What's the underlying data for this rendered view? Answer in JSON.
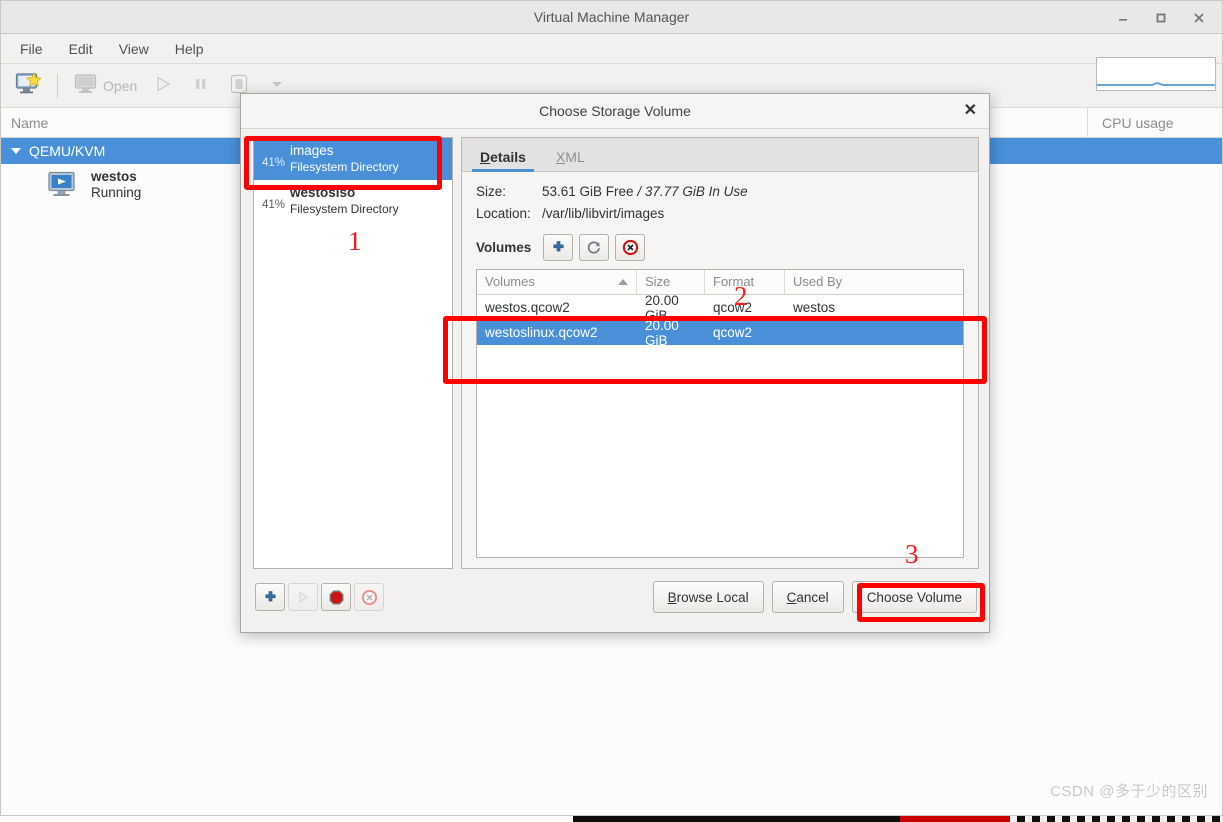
{
  "app": {
    "title": "Virtual Machine Manager",
    "window_controls": [
      {
        "name": "minimize",
        "glyph": "–"
      },
      {
        "name": "maximize",
        "glyph": "□"
      },
      {
        "name": "close",
        "glyph": "✕"
      }
    ],
    "menubar": [
      "File",
      "Edit",
      "View",
      "Help"
    ],
    "toolbar": {
      "new_vm_icon": "new-vm-icon",
      "open_label": "Open",
      "open_icon": "monitor-icon",
      "run_icon": "play-icon",
      "pause_icon": "pause-icon",
      "shutdown_icon": "shutdown-icon",
      "menu_icon": "chevron-down-icon"
    },
    "list": {
      "col_name": "Name",
      "col_cpu": "CPU usage",
      "connection": "QEMU/KVM",
      "vm_name": "westos",
      "vm_state": "Running"
    }
  },
  "dialog": {
    "title": "Choose Storage Volume",
    "close_glyph": "✕",
    "pools": [
      {
        "percent": "41%",
        "name": "images",
        "type": "Filesystem Directory",
        "selected": true
      },
      {
        "percent": "41%",
        "name": "westosiso",
        "type": "Filesystem Directory",
        "selected": false
      }
    ],
    "pool_buttons": [
      {
        "name": "add-pool-button",
        "glyph": "+",
        "enabled": true
      },
      {
        "name": "start-pool-button",
        "glyph": "▷",
        "enabled": false
      },
      {
        "name": "stop-pool-button",
        "glyph": "⬤",
        "enabled": true
      },
      {
        "name": "delete-pool-button",
        "glyph": "⊗",
        "enabled": false
      }
    ],
    "tabs": [
      {
        "label": "Details",
        "mnemonic": "D",
        "rest": "etails",
        "active": true
      },
      {
        "label": "XML",
        "mnemonic": "X",
        "rest": "ML",
        "active": false
      }
    ],
    "details": {
      "size_label": "Size:",
      "size_free": "53.61 GiB Free",
      "size_sep": "/",
      "size_used": "37.77 GiB In Use",
      "location_label": "Location:",
      "location_value": "/var/lib/libvirt/images",
      "volumes_label": "Volumes",
      "volume_buttons": [
        {
          "name": "add-volume-button",
          "glyph": "+",
          "enabled": true
        },
        {
          "name": "refresh-volumes-button",
          "glyph": "↻",
          "enabled": true
        },
        {
          "name": "delete-volume-button",
          "glyph": "⊗",
          "enabled": true
        }
      ]
    },
    "table": {
      "columns": [
        "Volumes",
        "Size",
        "Format",
        "Used By"
      ],
      "sorted_column": "Volumes",
      "sort_direction": "ascending",
      "rows": [
        {
          "volume": "westos.qcow2",
          "size": "20.00 GiB",
          "format": "qcow2",
          "used_by": "westos",
          "selected": false
        },
        {
          "volume": "westoslinux.qcow2",
          "size": "20.00 GiB",
          "format": "qcow2",
          "used_by": "",
          "selected": true
        }
      ]
    },
    "footer": {
      "browse_local": "Browse Local",
      "browse_local_mn": "B",
      "browse_local_rest": "rowse Local",
      "cancel": "Cancel",
      "cancel_mn": "C",
      "cancel_rest": "ancel",
      "choose_volume": "Choose Volume"
    }
  },
  "annotations": [
    {
      "number": "1",
      "target": "images pool row"
    },
    {
      "number": "2",
      "target": "westoslinux.qcow2 volume row"
    },
    {
      "number": "3",
      "target": "Choose Volume button"
    }
  ],
  "watermark": "CSDN @多于少的区别",
  "colors": {
    "selection_blue": "#4a90d9",
    "annotation_red": "#fe0000",
    "window_bg": "#f2f1f0",
    "accent_underline": "#4a90d9"
  }
}
